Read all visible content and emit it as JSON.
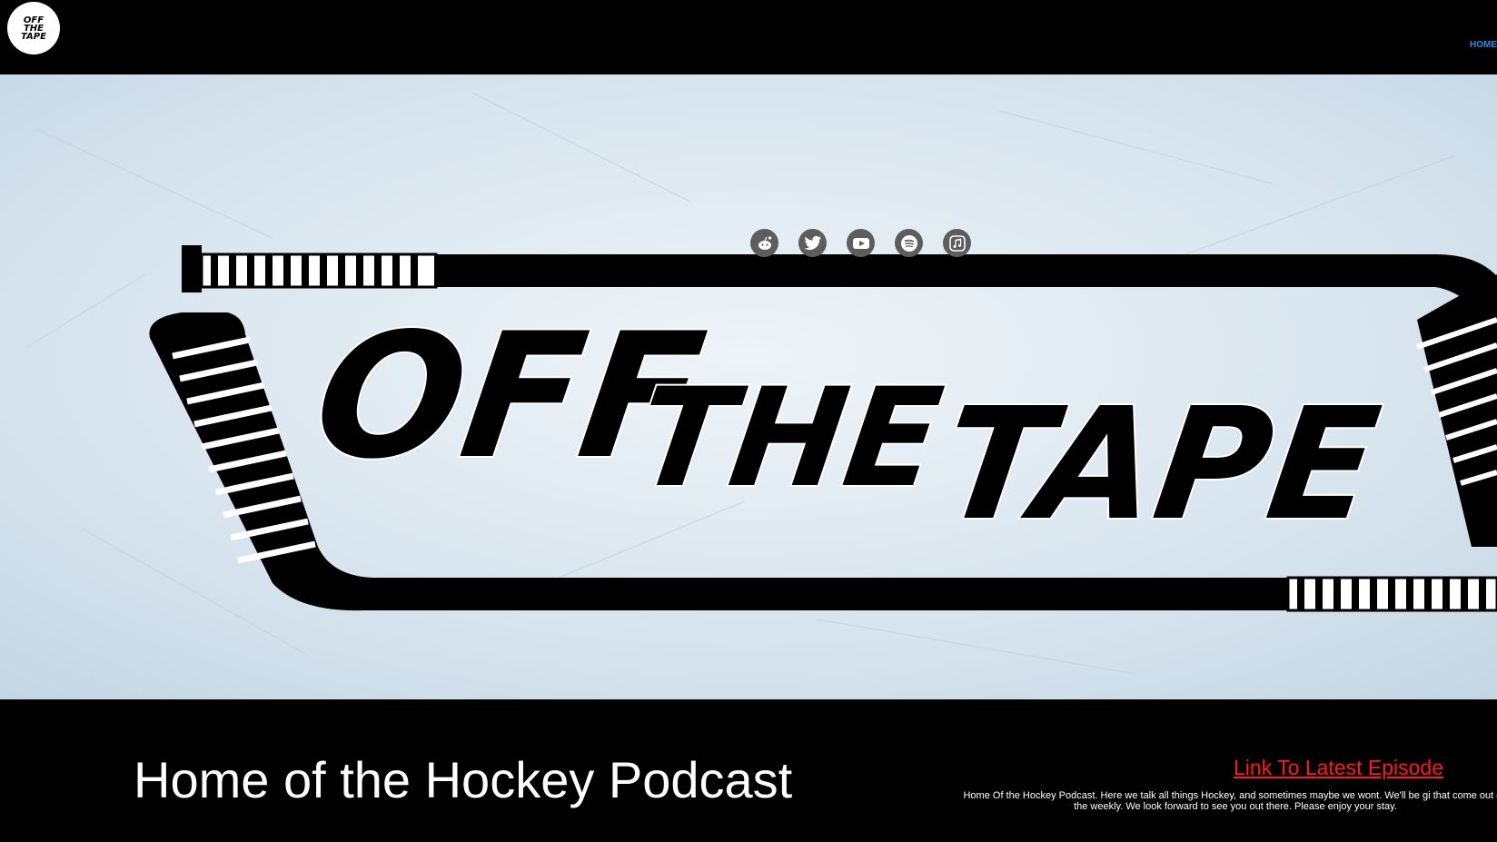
{
  "brand": {
    "logo_text": "OFF THE TAPE"
  },
  "nav": {
    "home_label": "HOME"
  },
  "hero": {
    "logo_words": [
      "OFF",
      "THE",
      "TAPE"
    ],
    "socials": [
      {
        "icon": "reddit-icon"
      },
      {
        "icon": "twitter-icon"
      },
      {
        "icon": "youtube-icon"
      },
      {
        "icon": "spotify-icon"
      },
      {
        "icon": "apple-podcasts-icon"
      }
    ]
  },
  "footer": {
    "tagline": "Home of the Hockey Podcast",
    "latest_link": "Link To Latest Episode",
    "about": "Home Of the Hockey Podcast. Here we talk all things Hockey, and sometimes maybe we wont. We'll be gi that come out on the weekly. We look forward to see you out there. Please enjoy your stay."
  },
  "colors": {
    "link_red": "#ff1a1a",
    "nav_blue": "#2a8fe5",
    "social_grey": "#5d5d5d"
  }
}
